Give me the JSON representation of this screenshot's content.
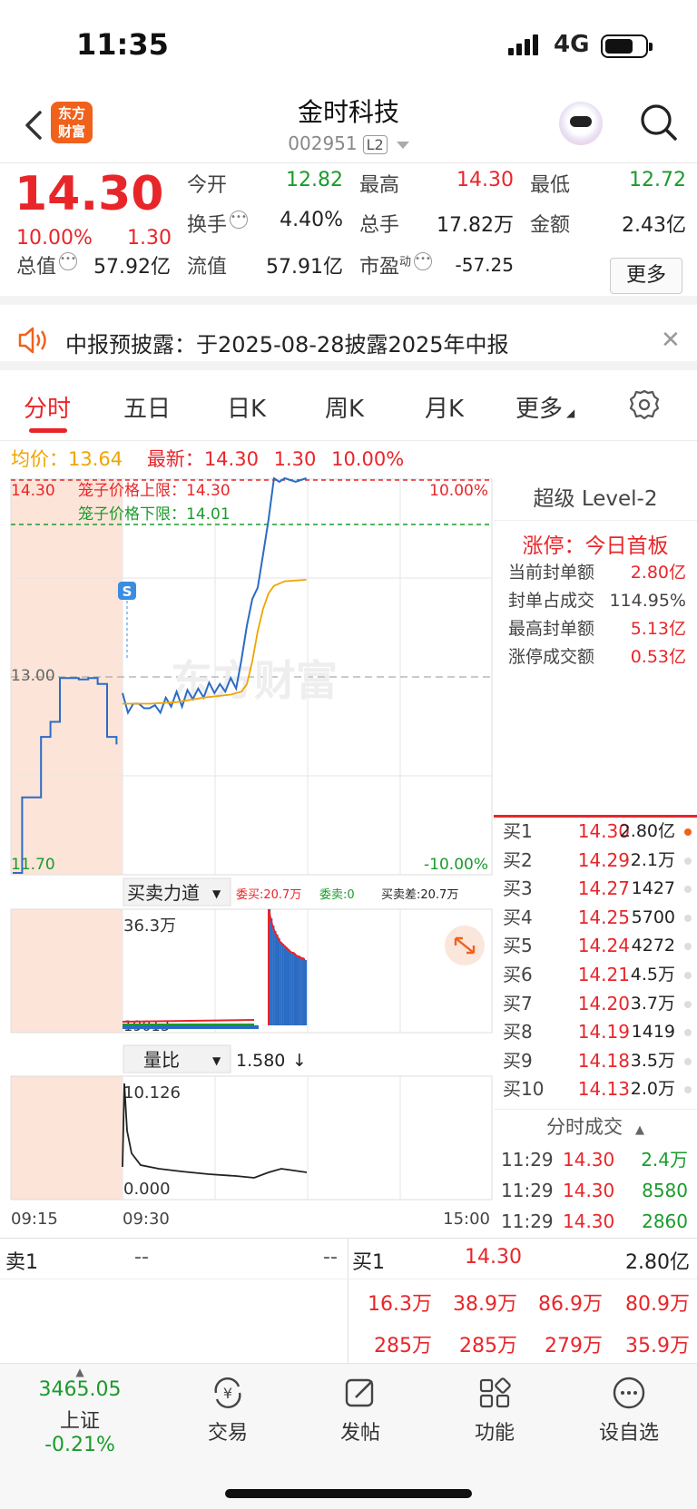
{
  "status_bar": {
    "time": "11:35",
    "network": "4G",
    "battery_fill": 0.72
  },
  "header": {
    "logo_line1": "东方",
    "logo_line2": "财富",
    "name": "金时科技",
    "code": "002951",
    "badge": "L2"
  },
  "quote": {
    "price": "14.30",
    "pct": "10.00%",
    "change": "1.30",
    "open_label": "今开",
    "open": "12.82",
    "high_label": "最高",
    "high": "14.30",
    "low_label": "最低",
    "low": "12.72",
    "turnover_label": "换手",
    "turnover": "4.40%",
    "volume_label": "总手",
    "volume": "17.82万",
    "amount_label": "金额",
    "amount": "2.43亿",
    "mktcap_label": "总值",
    "mktcap": "57.92亿",
    "float_label": "流值",
    "float": "57.91亿",
    "pe_label": "市盈",
    "pe_sup": "动",
    "pe": "-57.25",
    "more_label": "更多"
  },
  "notice": {
    "text": "中报预披露：于2025-08-28披露2025年中报"
  },
  "tabs": [
    "分时",
    "五日",
    "日K",
    "周K",
    "月K",
    "更多"
  ],
  "info_line": {
    "avg_label": "均价：",
    "avg": "13.64",
    "last_label": "最新：",
    "last": "14.30",
    "chg": "1.30",
    "pct": "10.00%"
  },
  "chart_data": {
    "type": "line",
    "title": "",
    "x_labels": [
      "09:15",
      "09:30",
      "15:00"
    ],
    "y_top": "14.30",
    "y_mid": "13.00",
    "y_bottom": "11.70",
    "pct_top": "10.00%",
    "pct_bottom": "-10.00%",
    "upper_cage": "笼子价格上限：14.30",
    "lower_cage": "笼子价格下限：14.01",
    "ylim": [
      11.7,
      14.3
    ],
    "series": [
      {
        "name": "price",
        "x": [
          0,
          2,
          4,
          6,
          8,
          10,
          12,
          14,
          16,
          18,
          20,
          22,
          24,
          26,
          28,
          30,
          32,
          34,
          36,
          38,
          40,
          42,
          44,
          46,
          48,
          50,
          52,
          54,
          56,
          58,
          60,
          64,
          68
        ],
        "y": [
          12.85,
          12.8,
          12.78,
          12.86,
          12.75,
          12.83,
          12.77,
          12.8,
          12.82,
          12.84,
          12.86,
          12.84,
          12.87,
          12.89,
          12.88,
          12.9,
          12.92,
          12.93,
          12.91,
          12.94,
          12.95,
          12.96,
          13.1,
          13.35,
          13.5,
          13.6,
          13.8,
          14.05,
          14.3,
          14.3,
          14.3,
          14.3,
          14.3
        ]
      },
      {
        "name": "avg",
        "x": [
          0,
          10,
          20,
          30,
          40,
          44,
          46,
          48,
          50,
          52,
          54,
          56,
          60,
          68
        ],
        "y": [
          12.82,
          12.82,
          12.83,
          12.86,
          12.88,
          12.9,
          12.95,
          13.1,
          13.3,
          13.45,
          13.55,
          13.6,
          13.63,
          13.64
        ]
      }
    ],
    "pre_market": {
      "x": [
        0,
        2,
        4,
        6,
        8,
        10,
        12,
        14,
        16,
        18,
        20,
        22
      ],
      "y": [
        11.7,
        12.2,
        12.2,
        12.6,
        12.7,
        12.99,
        12.99,
        12.98,
        12.99,
        12.95,
        12.6,
        12.55
      ]
    }
  },
  "force_panel": {
    "label": "买卖力道",
    "wt_buy": "委买:20.7万",
    "wt_sell": "委卖:0",
    "diff": "买卖差:20.7万",
    "top_value": "36.3万",
    "bottom_value": "19013"
  },
  "ratio_panel": {
    "label": "量比",
    "value": "1.580",
    "top_value": "10.126",
    "bottom_value": "0.000"
  },
  "level2": {
    "title": "超级 Level-2",
    "limit_up": "涨停：今日首板",
    "rows": [
      {
        "label": "当前封单额",
        "value": "2.80亿"
      },
      {
        "label": "封单占成交",
        "value": "114.95%"
      },
      {
        "label": "最高封单额",
        "value": "5.13亿"
      },
      {
        "label": "涨停成交额",
        "value": "0.53亿"
      }
    ]
  },
  "order_book": [
    {
      "label": "买1",
      "price": "14.30",
      "vol": "2.80亿"
    },
    {
      "label": "买2",
      "price": "14.29",
      "vol": "2.1万"
    },
    {
      "label": "买3",
      "price": "14.27",
      "vol": "1427"
    },
    {
      "label": "买4",
      "price": "14.25",
      "vol": "5700"
    },
    {
      "label": "买5",
      "price": "14.24",
      "vol": "4272"
    },
    {
      "label": "买6",
      "price": "14.21",
      "vol": "4.5万"
    },
    {
      "label": "买7",
      "price": "14.20",
      "vol": "3.7万"
    },
    {
      "label": "买8",
      "price": "14.19",
      "vol": "1419"
    },
    {
      "label": "买9",
      "price": "14.18",
      "vol": "3.5万"
    },
    {
      "label": "买10",
      "price": "14.13",
      "vol": "2.0万"
    }
  ],
  "ticks": {
    "title": "分时成交",
    "rows": [
      {
        "time": "11:29",
        "price": "14.30",
        "vol": "2.4万"
      },
      {
        "time": "11:29",
        "price": "14.30",
        "vol": "8580"
      },
      {
        "time": "11:29",
        "price": "14.30",
        "vol": "2860"
      }
    ]
  },
  "bottom_quote": {
    "sell_label": "卖1",
    "sell_price": "--",
    "sell_vol": "--",
    "buy_label": "买1",
    "buy_price": "14.30",
    "buy_vol": "2.80亿",
    "row2": [
      "16.3万",
      "38.9万",
      "86.9万",
      "80.9万"
    ],
    "row3": [
      "285万",
      "285万",
      "279万",
      "35.9万"
    ]
  },
  "tab_bar": {
    "index_value": "3465.05",
    "index_name": "上证",
    "index_change": "-0.21%",
    "trade": "交易",
    "post": "发帖",
    "functions": "功能",
    "watchlist": "设自选"
  },
  "colors": {
    "up": "#e8262a",
    "down": "#1a9b2c",
    "avg": "#f0a400",
    "price_line": "#2b6cc4",
    "premarket_bg": "#fde4d8"
  }
}
